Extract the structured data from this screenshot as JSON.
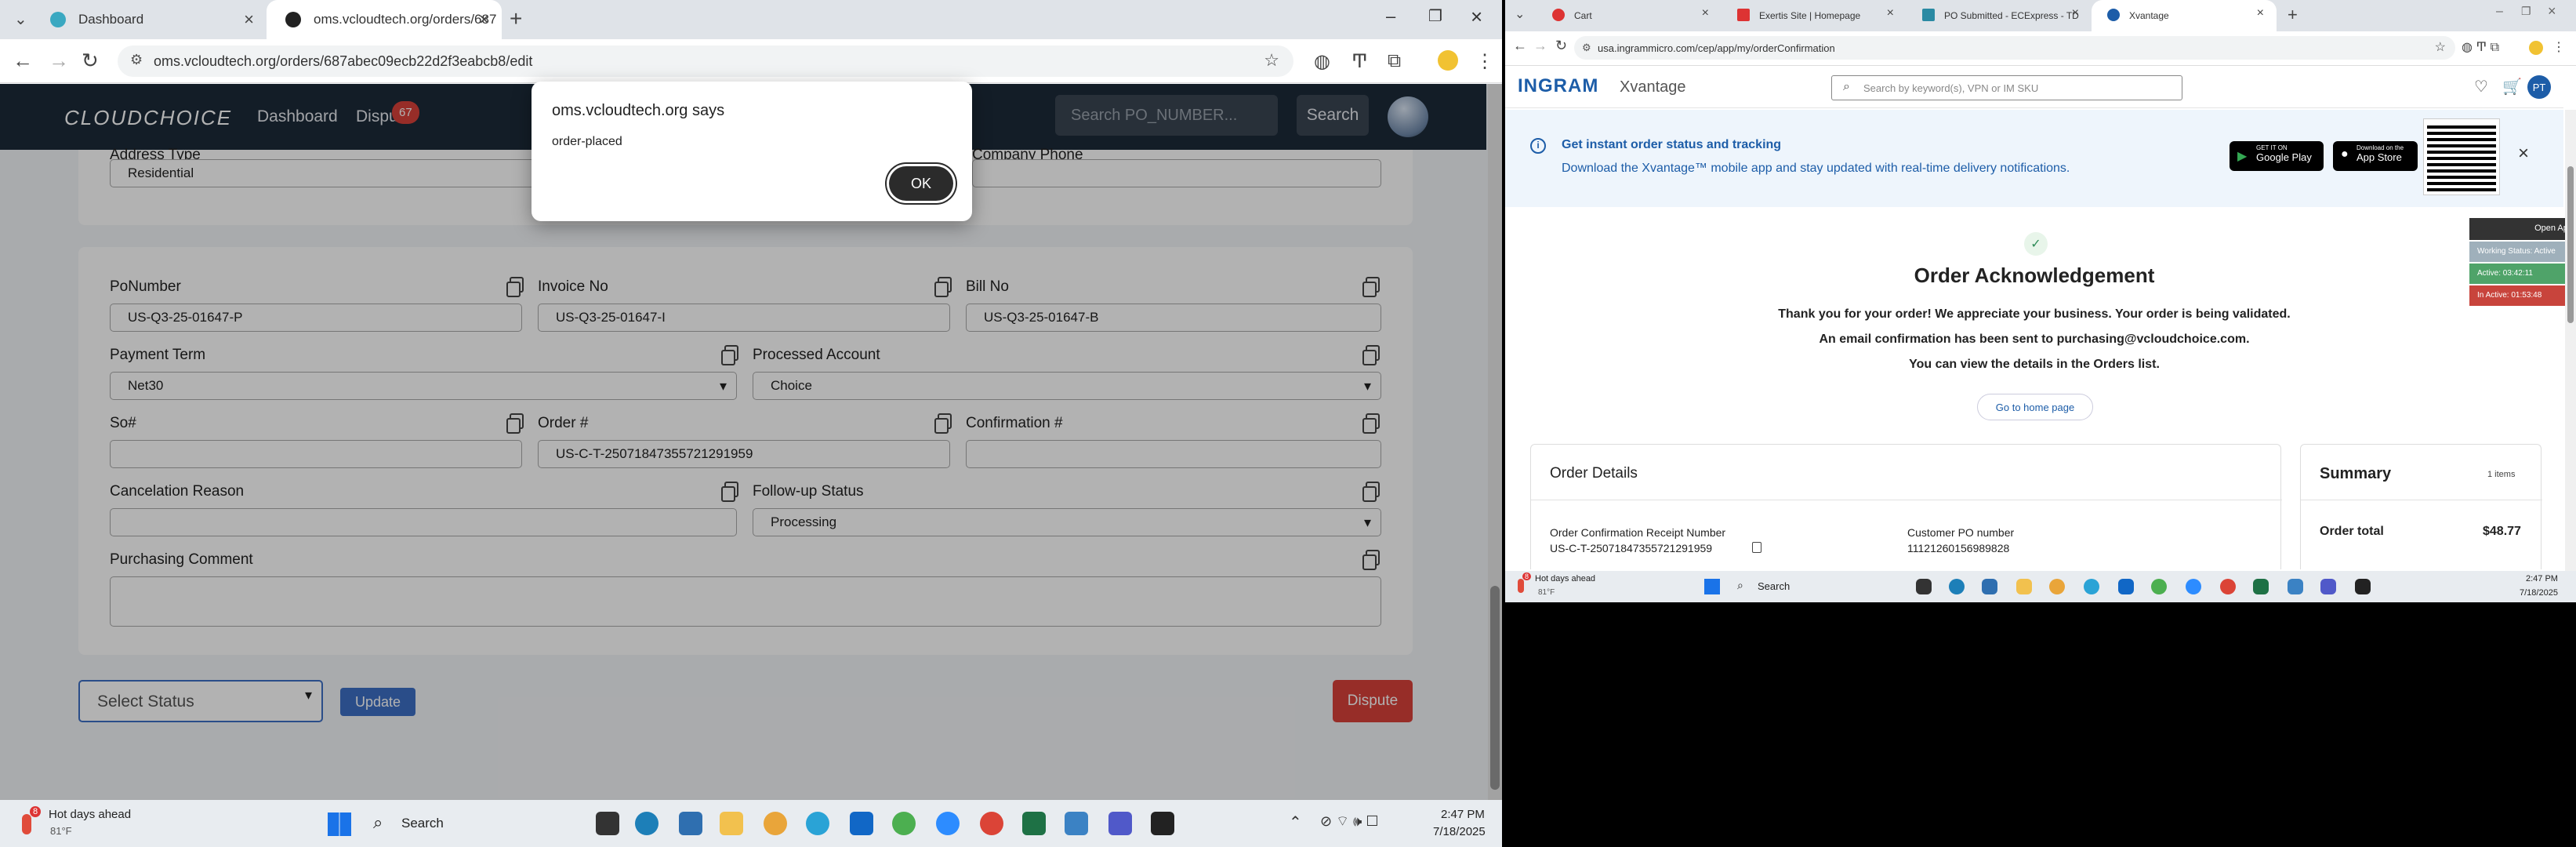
{
  "left": {
    "tabs": [
      {
        "label": "Dashboard"
      },
      {
        "label": "oms.vcloudtech.org/orders/687"
      }
    ],
    "url": "oms.vcloudtech.org/orders/687abec09ecb22d2f3eabcb8/edit",
    "brand": "CLOUDCHOICE",
    "nav": {
      "dashboard": "Dashboard",
      "disputes": "Dispu",
      "disputes_count": "67",
      "search_placeholder": "Search PO_NUMBER...",
      "search_button": "Search"
    },
    "top_partial": {
      "address_type_label": "Address Type",
      "address_type_value": "Residential",
      "company_phone_label": "Company Phone"
    },
    "form": {
      "po_number": {
        "label": "PoNumber",
        "value": "US-Q3-25-01647-P"
      },
      "invoice_no": {
        "label": "Invoice No",
        "value": "US-Q3-25-01647-I"
      },
      "bill_no": {
        "label": "Bill No",
        "value": "US-Q3-25-01647-B"
      },
      "payment_term": {
        "label": "Payment Term",
        "value": "Net30"
      },
      "processed_account": {
        "label": "Processed Account",
        "value": "Choice"
      },
      "so": {
        "label": "So#",
        "value": ""
      },
      "order": {
        "label": "Order #",
        "value": "US-C-T-25071847355721291959"
      },
      "confirmation": {
        "label": "Confirmation #",
        "value": ""
      },
      "cancelation_reason": {
        "label": "Cancelation Reason",
        "value": ""
      },
      "followup_status": {
        "label": "Follow-up Status",
        "value": "Processing"
      },
      "purchasing_comment": {
        "label": "Purchasing Comment",
        "value": ""
      }
    },
    "actions": {
      "select_status": "Select Status",
      "update": "Update",
      "dispute": "Dispute"
    },
    "dialog": {
      "title": "oms.vcloudtech.org says",
      "message": "order-placed",
      "ok": "OK"
    },
    "taskbar": {
      "weather_title": "Hot days ahead",
      "weather_temp": "81°F",
      "weather_badge": "8",
      "search": "Search",
      "time": "2:47 PM",
      "date": "7/18/2025"
    }
  },
  "right": {
    "tabs": [
      {
        "label": "Cart"
      },
      {
        "label": "Exertis Site | Homepage"
      },
      {
        "label": "PO Submitted - ECExpress - TD"
      },
      {
        "label": "Xvantage"
      }
    ],
    "url": "usa.ingrammicro.com/cep/app/my/orderConfirmation",
    "brand_logo": "INGRAM",
    "brand_product": "Xvantage",
    "search_placeholder": "Search by keyword(s), VPN or IM SKU",
    "avatar": "PT",
    "banner": {
      "title": "Get instant order status and tracking",
      "text": "Download the Xvantage™ mobile app and stay updated with real-time delivery notifications.",
      "google_small": "GET IT ON",
      "google": "Google Play",
      "apple_small": "Download on the",
      "apple": "App Store"
    },
    "side_widget": {
      "open": "Open App",
      "working": "Working Status: Active",
      "active": "Active: 03:42:11",
      "inactive": "In Active: 01:53:48"
    },
    "ack": {
      "title": "Order Acknowledgement",
      "line1": "Thank you for your order! We appreciate your business. Your order is being validated.",
      "line2": "An email confirmation has been sent to purchasing@vcloudchoice.com.",
      "line3": "You can view the details in the Orders list.",
      "home_button": "Go to home page"
    },
    "details": {
      "title": "Order Details",
      "receipt_label": "Order Confirmation Receipt Number",
      "receipt_value": "US-C-T-25071847355721291959",
      "po_label": "Customer PO number",
      "po_value": "11121260156989828"
    },
    "summary": {
      "title": "Summary",
      "items": "1 items",
      "total_label": "Order total",
      "total_value": "$48.77"
    },
    "taskbar": {
      "weather_title": "Hot days ahead",
      "weather_temp": "81°F",
      "weather_badge": "8",
      "search": "Search",
      "time": "2:47 PM",
      "date": "7/18/2025"
    }
  },
  "colors": {
    "navbar": "#1c2a38",
    "dispute_red": "#d9413a",
    "update_blue": "#3d6fc4",
    "ingram_blue": "#1d5da8",
    "widget_green": "#4fa369",
    "widget_red": "#c8443c"
  }
}
